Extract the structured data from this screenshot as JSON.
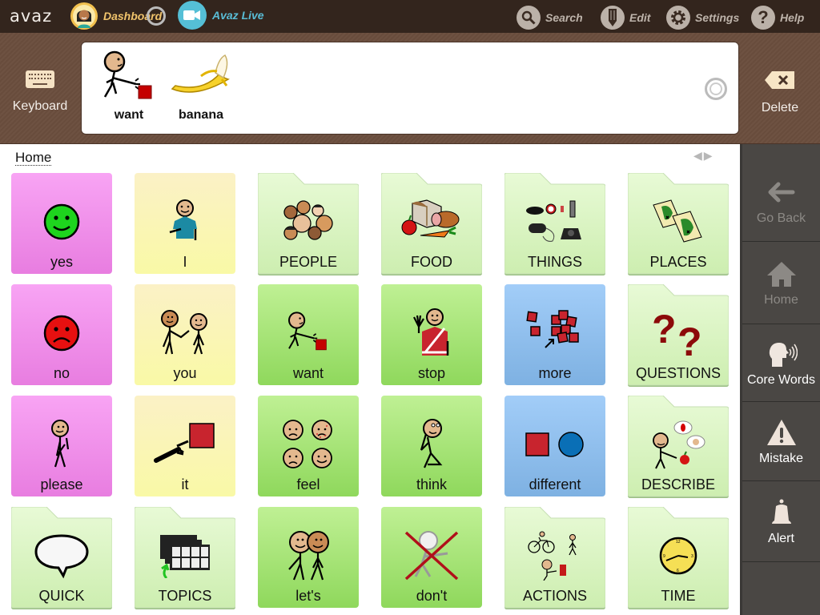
{
  "topbar": {
    "logo": "avaz",
    "dashboard_label": "Dashboard",
    "live_label": "Avaz Live",
    "search_label": "Search",
    "edit_label": "Edit",
    "settings_label": "Settings",
    "help_label": "Help"
  },
  "message_bar": {
    "keyboard_label": "Keyboard",
    "delete_label": "Delete",
    "words": [
      {
        "label": "want",
        "icon": "want-picture"
      },
      {
        "label": "banana",
        "icon": "banana-picture"
      }
    ]
  },
  "breadcrumb": "Home",
  "pager": {
    "prev": "◀",
    "next": "▶"
  },
  "grid": {
    "cells": [
      {
        "label": "yes",
        "type": "word",
        "color": "pink",
        "icon": "happy-face"
      },
      {
        "label": "I",
        "type": "word",
        "color": "yellow",
        "icon": "person-self"
      },
      {
        "label": "PEOPLE",
        "type": "folder",
        "icon": "people-group"
      },
      {
        "label": "FOOD",
        "type": "folder",
        "icon": "food"
      },
      {
        "label": "THINGS",
        "type": "folder",
        "icon": "things"
      },
      {
        "label": "PLACES",
        "type": "folder",
        "icon": "maps"
      },
      {
        "label": "no",
        "type": "word",
        "color": "pink",
        "icon": "sad-face"
      },
      {
        "label": "you",
        "type": "word",
        "color": "yellow",
        "icon": "person-pointing"
      },
      {
        "label": "want",
        "type": "word",
        "color": "green",
        "icon": "want-picture"
      },
      {
        "label": "stop",
        "type": "word",
        "color": "green",
        "icon": "stop-hand"
      },
      {
        "label": "more",
        "type": "word",
        "color": "blue",
        "icon": "more-squares"
      },
      {
        "label": "QUESTIONS",
        "type": "folder",
        "icon": "question-marks"
      },
      {
        "label": "please",
        "type": "word",
        "color": "pink",
        "icon": "person-please"
      },
      {
        "label": "it",
        "type": "word",
        "color": "yellow",
        "icon": "point-square"
      },
      {
        "label": "feel",
        "type": "word",
        "color": "green",
        "icon": "feelings-faces"
      },
      {
        "label": "think",
        "type": "word",
        "color": "green",
        "icon": "person-thinking"
      },
      {
        "label": "different",
        "type": "word",
        "color": "blue",
        "icon": "square-circle"
      },
      {
        "label": "DESCRIBE",
        "type": "folder",
        "icon": "describe"
      },
      {
        "label": "QUICK",
        "type": "folder",
        "icon": "speech-bubble"
      },
      {
        "label": "TOPICS",
        "type": "folder",
        "icon": "topic-boards"
      },
      {
        "label": "let's",
        "type": "word",
        "color": "green",
        "icon": "two-people"
      },
      {
        "label": "don't",
        "type": "word",
        "color": "green",
        "icon": "crossed-person"
      },
      {
        "label": "ACTIONS",
        "type": "folder",
        "icon": "actions"
      },
      {
        "label": "TIME",
        "type": "folder",
        "icon": "clock"
      }
    ]
  },
  "sidebar": {
    "go_back": "Go Back",
    "home": "Home",
    "core_words": "Core Words",
    "mistake": "Mistake",
    "alert": "Alert"
  },
  "colors": {
    "topbar_bg": "#33251d",
    "dashboard_accent": "#f1c46c",
    "live_accent": "#59bcd5",
    "pink_tile": "#f29ae9",
    "yellow_tile": "#fbf5b8",
    "green_tile": "#a8e57a",
    "blue_tile": "#93c2f0",
    "folder_tile": "#dcf5c4",
    "sidebar_bg": "#4a4744"
  }
}
